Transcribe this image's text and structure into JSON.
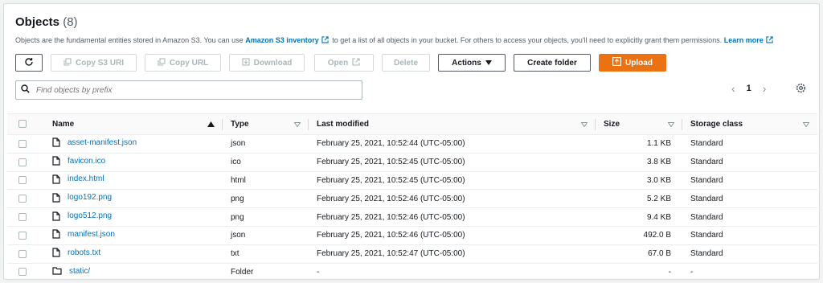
{
  "header": {
    "title": "Objects",
    "count": "(8)",
    "desc_pre": "Objects are the fundamental entities stored in Amazon S3. You can use",
    "desc_link1": "Amazon S3 inventory",
    "desc_mid": "to get a list of all objects in your bucket. For others to access your objects, you'll need to explicitly grant them permissions.",
    "desc_link2": "Learn more"
  },
  "toolbar": {
    "copy_s3_uri": "Copy S3 URI",
    "copy_url": "Copy URL",
    "download": "Download",
    "open": "Open",
    "delete": "Delete",
    "actions": "Actions",
    "create_folder": "Create folder",
    "upload": "Upload"
  },
  "search": {
    "placeholder": "Find objects by prefix"
  },
  "pagination": {
    "page": "1"
  },
  "table": {
    "headers": {
      "name": "Name",
      "type": "Type",
      "last_modified": "Last modified",
      "size": "Size",
      "storage_class": "Storage class"
    },
    "rows": [
      {
        "name": "asset-manifest.json",
        "type": "json",
        "modified": "February 25, 2021, 10:52:44 (UTC-05:00)",
        "size": "1.1 KB",
        "storage": "Standard",
        "kind": "file"
      },
      {
        "name": "favicon.ico",
        "type": "ico",
        "modified": "February 25, 2021, 10:52:45 (UTC-05:00)",
        "size": "3.8 KB",
        "storage": "Standard",
        "kind": "file"
      },
      {
        "name": "index.html",
        "type": "html",
        "modified": "February 25, 2021, 10:52:45 (UTC-05:00)",
        "size": "3.0 KB",
        "storage": "Standard",
        "kind": "file"
      },
      {
        "name": "logo192.png",
        "type": "png",
        "modified": "February 25, 2021, 10:52:46 (UTC-05:00)",
        "size": "5.2 KB",
        "storage": "Standard",
        "kind": "file"
      },
      {
        "name": "logo512.png",
        "type": "png",
        "modified": "February 25, 2021, 10:52:46 (UTC-05:00)",
        "size": "9.4 KB",
        "storage": "Standard",
        "kind": "file"
      },
      {
        "name": "manifest.json",
        "type": "json",
        "modified": "February 25, 2021, 10:52:46 (UTC-05:00)",
        "size": "492.0 B",
        "storage": "Standard",
        "kind": "file"
      },
      {
        "name": "robots.txt",
        "type": "txt",
        "modified": "February 25, 2021, 10:52:47 (UTC-05:00)",
        "size": "67.0 B",
        "storage": "Standard",
        "kind": "file"
      },
      {
        "name": "static/",
        "type": "Folder",
        "modified": "-",
        "size": "-",
        "storage": "-",
        "kind": "folder"
      }
    ]
  },
  "colors": {
    "link": "#0073bb",
    "primary": "#ec7211",
    "border": "#aab7b8"
  }
}
